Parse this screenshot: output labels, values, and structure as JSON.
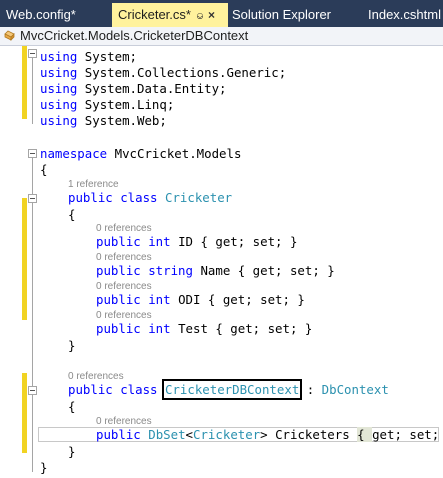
{
  "tabs": [
    {
      "label": "Web.config*",
      "active": false
    },
    {
      "label": "Cricketer.cs*",
      "active": true
    },
    {
      "label": "Solution Explorer",
      "active": false
    },
    {
      "label": "Index.cshtml",
      "active": false
    }
  ],
  "tab_icons": {
    "pin": "pin-icon",
    "close": "close-icon"
  },
  "breadcrumb": {
    "label": "MvcCricket.Models.CricketerDBContext",
    "icon": "class-icon"
  },
  "colors": {
    "keyword": "#0000ff",
    "type": "#2b91af",
    "tab_active": "#fff29d",
    "tabbar": "#2b3c59",
    "changed_margin": "#f1d322"
  },
  "code": {
    "using1": "using System;",
    "using2": "using System.Collections.Generic;",
    "using3": "using System.Data.Entity;",
    "using4": "using System.Linq;",
    "using5": "using System.Web;",
    "kw_using": "using",
    "ns_kw": "namespace",
    "ns_name": "MvcCricket.Models",
    "open_brace": "{",
    "close_brace": "}",
    "lens_cricketer": "1 reference",
    "class1_kw": "public class",
    "class1_name": "Cricketer",
    "lens_id": "0 references",
    "prop_id_kw": "public int",
    "prop_id_rest": "ID { get; set; }",
    "lens_name": "0 references",
    "prop_name_kw": "public string",
    "prop_name_rest": "Name { get; set; }",
    "lens_odi": "0 references",
    "prop_odi_kw": "public int",
    "prop_odi_rest": "ODI { get; set; }",
    "lens_test": "0 references",
    "prop_test_kw": "public int",
    "prop_test_rest": "Test { get; set; }",
    "lens_context": "0 references",
    "class2_kw": "public class",
    "class2_name": "CricketerDBContext",
    "class2_colon": " : ",
    "class2_base": "DbContext",
    "lens_dbset": "0 references",
    "dbset_kw": "public",
    "dbset_type": "DbSet",
    "dbset_lt": "<",
    "dbset_arg": "Cricketer",
    "dbset_gt": ">",
    "dbset_rest": " Cricketers ",
    "dbset_accessors": "get; set; ",
    "dbset_open": "{ ",
    "dbset_close": "}"
  }
}
